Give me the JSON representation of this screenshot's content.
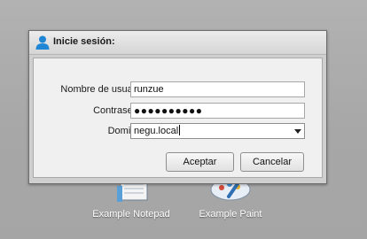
{
  "desktop": {
    "icons": [
      {
        "label": "Example Notepad",
        "icon": "notepad-icon"
      },
      {
        "label": "Example Paint",
        "icon": "paint-icon"
      }
    ]
  },
  "dialog": {
    "title": "Inicie sesión:",
    "title_icon": "user-icon",
    "username_label": "Nombre de usuario:",
    "username_value": "runzue",
    "password_label": "Contraseña:",
    "password_masked": "●●●●●●●●●●",
    "domain_label": "Dominio:",
    "domain_value": "negu.local",
    "accept_label": "Aceptar",
    "cancel_label": "Cancelar"
  },
  "colors": {
    "desktop_bg": "#aaaaaa",
    "dialog_frame": "#cfcfcf",
    "panel_bg": "#f0f0f0",
    "user_icon_blue": "#1f86d6"
  }
}
